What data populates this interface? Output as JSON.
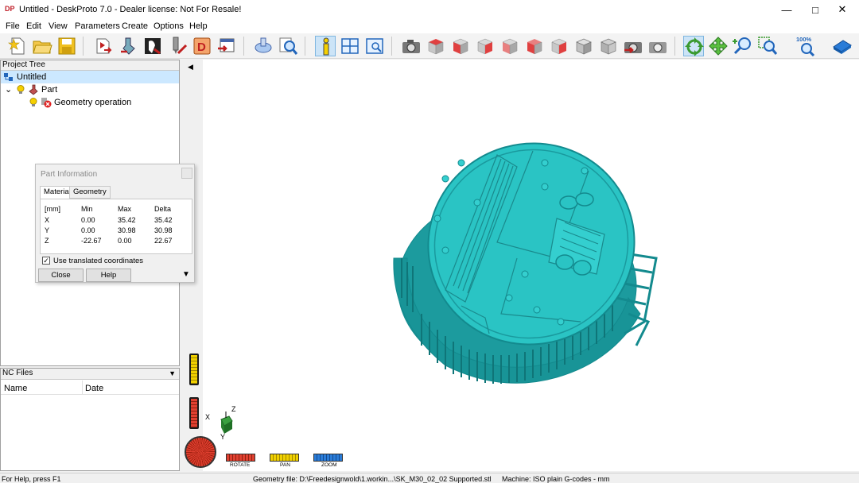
{
  "window": {
    "title": "Untitled - DeskProto 7.0 - Dealer license: Not For Resale!",
    "icon_text": "DP"
  },
  "menu": [
    "File",
    "Edit",
    "View",
    "Parameters",
    "Create",
    "Options",
    "Help"
  ],
  "toolbar": {
    "zoom_level": "100%"
  },
  "project_tree": {
    "header": "Project Tree",
    "root": "Untitled",
    "part": "Part",
    "operation": "Geometry operation"
  },
  "nc_files": {
    "header": "NC Files",
    "col_name": "Name",
    "col_date": "Date"
  },
  "part_info": {
    "title": "Part Information",
    "tabs": [
      "Material",
      "Geometry"
    ],
    "unit": "[mm]",
    "cols": [
      "Min",
      "Max",
      "Delta"
    ],
    "rows": [
      {
        "axis": "X",
        "min": "0.00",
        "max": "35.42",
        "delta": "35.42"
      },
      {
        "axis": "Y",
        "min": "0.00",
        "max": "30.98",
        "delta": "30.98"
      },
      {
        "axis": "Z",
        "min": "-22.67",
        "max": "0.00",
        "delta": "22.67"
      }
    ],
    "checkbox_label": "Use translated coordinates",
    "close_label": "Close",
    "help_label": "Help"
  },
  "view_controls": {
    "rotate": "ROTATE",
    "pan": "PAN",
    "zoom": "ZOOM"
  },
  "axes": {
    "x": "X",
    "y": "Y",
    "z": "Z"
  },
  "status": {
    "help": "For Help, press F1",
    "geometry_file": "Geometry file: D:\\Freedesignwold\\1.workin...\\SK_M30_02_02 Supported.stl",
    "machine": "Machine: ISO plain G-codes - mm"
  },
  "colors": {
    "model": "#2ac4c4",
    "model_dark": "#138a8e",
    "accent": "#1f77d4"
  }
}
